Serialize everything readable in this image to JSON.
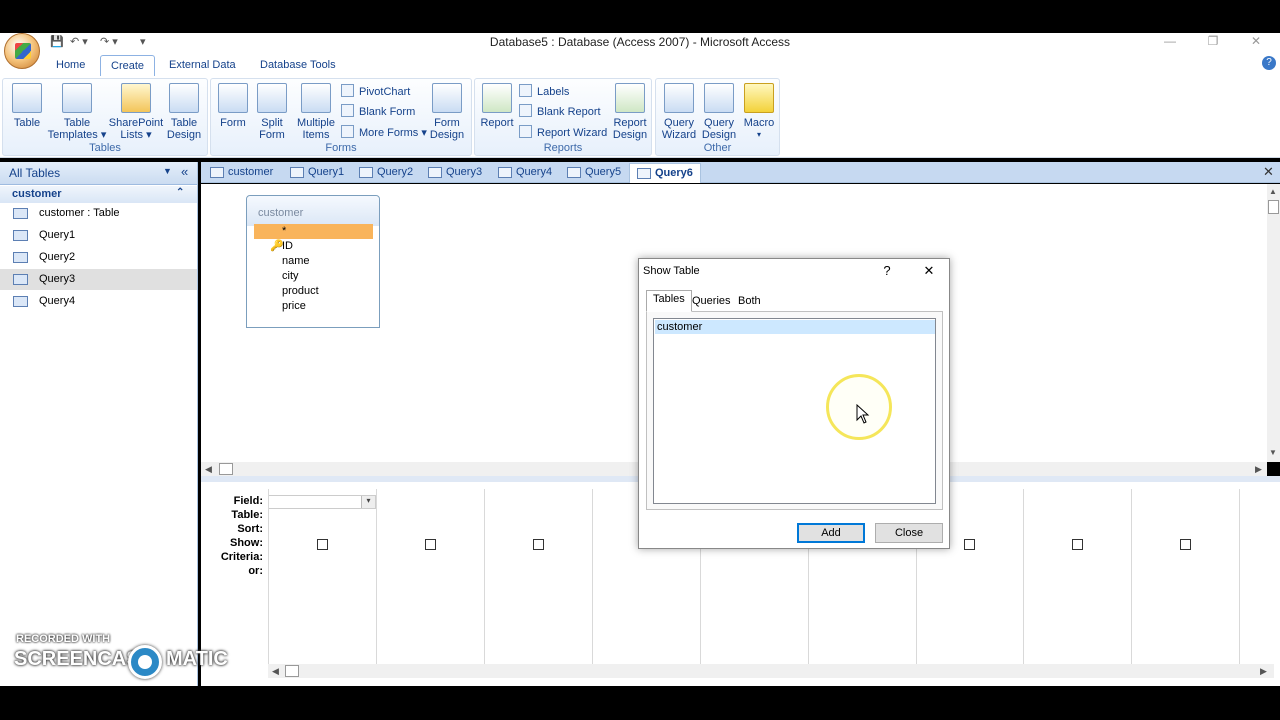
{
  "window": {
    "title": "Database5 : Database (Access 2007) - Microsoft Access"
  },
  "ribbon_tabs": [
    "Home",
    "Create",
    "External Data",
    "Database Tools"
  ],
  "ribbon": {
    "tables": {
      "label": "Tables",
      "table": "Table",
      "table_templates": "Table Templates ▾",
      "sharepoint_lists": "SharePoint Lists ▾",
      "table_design": "Table Design"
    },
    "forms": {
      "label": "Forms",
      "form": "Form",
      "split_form": "Split Form",
      "multiple_items": "Multiple Items",
      "pivotchart": "PivotChart",
      "blank_form": "Blank Form",
      "more_forms": "More Forms ▾",
      "form_design": "Form Design"
    },
    "reports": {
      "label": "Reports",
      "report": "Report",
      "labels": "Labels",
      "blank_report": "Blank Report",
      "report_wizard": "Report Wizard",
      "report_design": "Report Design"
    },
    "other": {
      "label": "Other",
      "query_wizard": "Query Wizard",
      "query_design": "Query Design",
      "macro": "Macro"
    }
  },
  "nav": {
    "header": "All Tables",
    "group": "customer",
    "items": [
      "customer : Table",
      "Query1",
      "Query2",
      "Query3",
      "Query4"
    ]
  },
  "doc_tabs": [
    "customer",
    "Query1",
    "Query2",
    "Query3",
    "Query4",
    "Query5",
    "Query6"
  ],
  "field_list": {
    "title": "customer",
    "fields": [
      "*",
      "ID",
      "name",
      "city",
      "product",
      "price"
    ]
  },
  "grid": {
    "row_labels": [
      "Field:",
      "Table:",
      "Sort:",
      "Show:",
      "Criteria:",
      "or:"
    ]
  },
  "dialog": {
    "title": "Show Table",
    "help": "?",
    "close_x": "✕",
    "tabs": [
      "Tables",
      "Queries",
      "Both"
    ],
    "list_items": [
      "customer"
    ],
    "add_button": "Add",
    "close_button": "Close"
  },
  "watermark": {
    "line1": "RECORDED WITH",
    "line2a": "SCREENCAST",
    "line2b": "MATIC"
  }
}
